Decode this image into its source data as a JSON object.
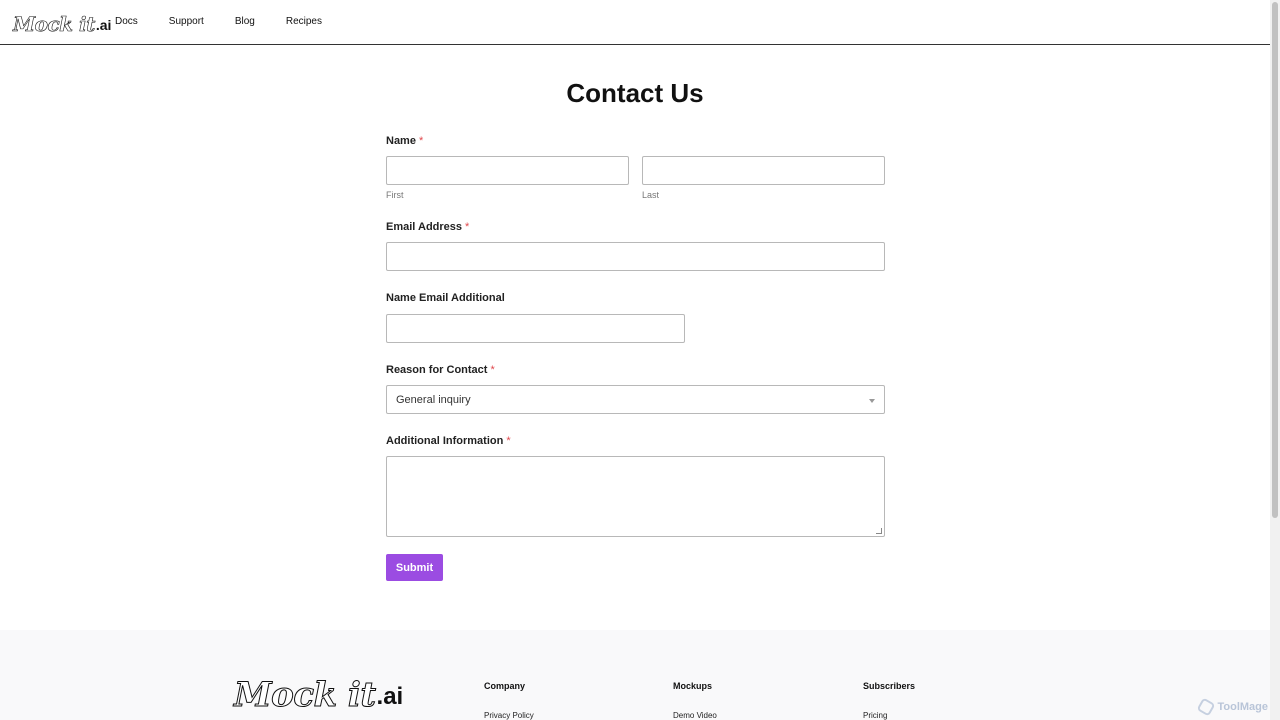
{
  "header": {
    "logo_script": "Mock it",
    "logo_suffix": ".ai",
    "nav": [
      "Docs",
      "Support",
      "Blog",
      "Recipes"
    ]
  },
  "form": {
    "title": "Contact Us",
    "name_label": "Name",
    "required_marker": "*",
    "first_value": "",
    "first_sublabel": "First",
    "last_value": "",
    "last_sublabel": "Last",
    "email_label": "Email Address",
    "email_value": "",
    "name_email_additional_label": "Name Email Additional",
    "name_email_additional_value": "",
    "reason_label": "Reason for Contact",
    "reason_selected": "General inquiry",
    "info_label": "Additional Information",
    "info_value": "",
    "submit_label": "Submit"
  },
  "footer": {
    "logo_script": "Mock it",
    "logo_suffix": ".ai",
    "columns": [
      {
        "title": "Company",
        "first_link": "Privacy Policy"
      },
      {
        "title": "Mockups",
        "first_link": "Demo Video"
      },
      {
        "title": "Subscribers",
        "first_link": "Pricing"
      }
    ]
  },
  "watermark": "ToolMage"
}
